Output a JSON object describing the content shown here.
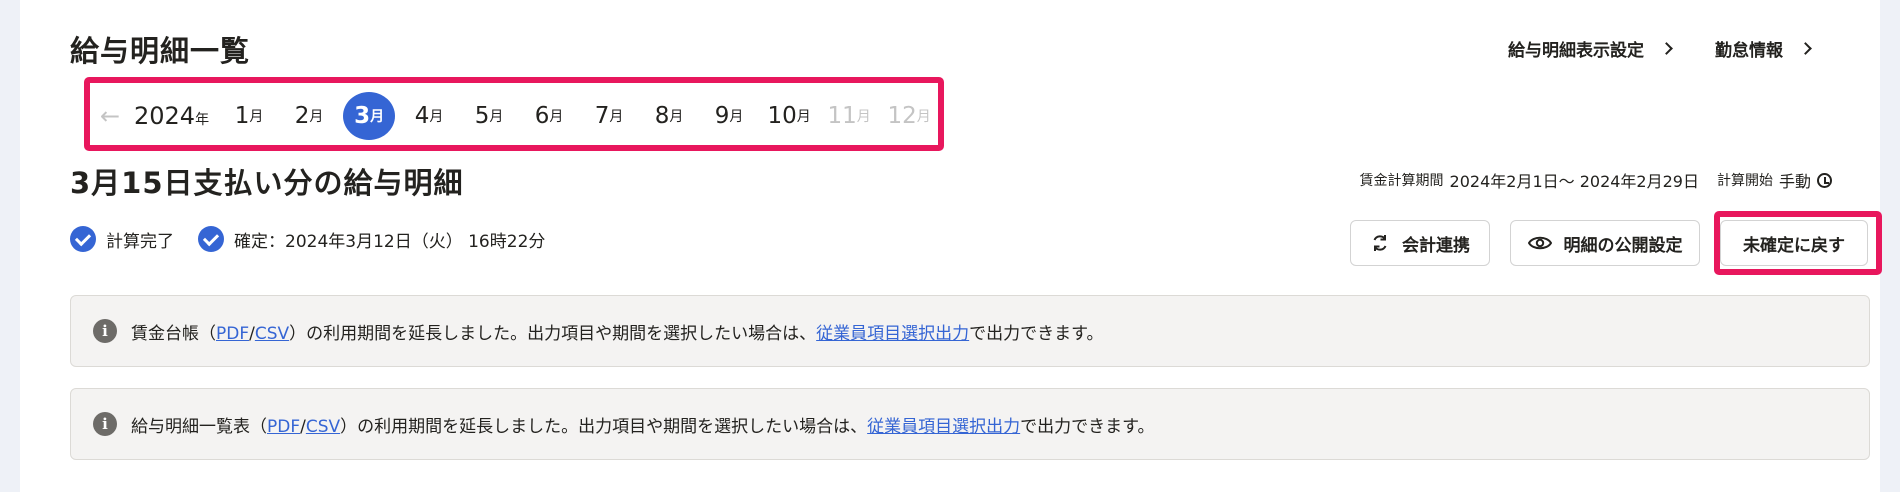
{
  "page_title": "給与明細一覧",
  "top_links": [
    {
      "label": "給与明細表示設定"
    },
    {
      "label": "勤怠情報"
    }
  ],
  "month_nav": {
    "year": "2024",
    "year_unit": "年",
    "month_unit": "月",
    "months": [
      "1",
      "2",
      "3",
      "4",
      "5",
      "6",
      "7",
      "8",
      "9",
      "10",
      "11",
      "12"
    ],
    "active_month": "3",
    "disabled_months": [
      "11",
      "12"
    ]
  },
  "section_title": "3月15日支払い分の給与明細",
  "period": {
    "label": "賃金計算期間",
    "value": "2024年2月1日〜 2024年2月29日",
    "calc_label": "計算開始",
    "calc_value": "手動"
  },
  "status": {
    "done": "計算完了",
    "confirmed": "確定：2024年3月12日（火） 16時22分"
  },
  "buttons": {
    "sync": "会計連携",
    "public": "明細の公開設定",
    "revert": "未確定に戻す"
  },
  "notices": [
    {
      "before": "賃金台帳（",
      "pdf": "PDF",
      "slash": "/",
      "csv": "CSV",
      "middle": "）の利用期間を延長しました。出力項目や期間を選択したい場合は、",
      "link": "従業員項目選択出力",
      "after": "で出力できます。"
    },
    {
      "before": "給与明細一覧表（",
      "pdf": "PDF",
      "slash": "/",
      "csv": "CSV",
      "middle": "）の利用期間を延長しました。出力項目や期間を選択したい場合は、",
      "link": "従業員項目選択出力",
      "after": "で出力できます。"
    }
  ],
  "colors": {
    "accent": "#3565d4",
    "highlight": "#e8175d"
  }
}
